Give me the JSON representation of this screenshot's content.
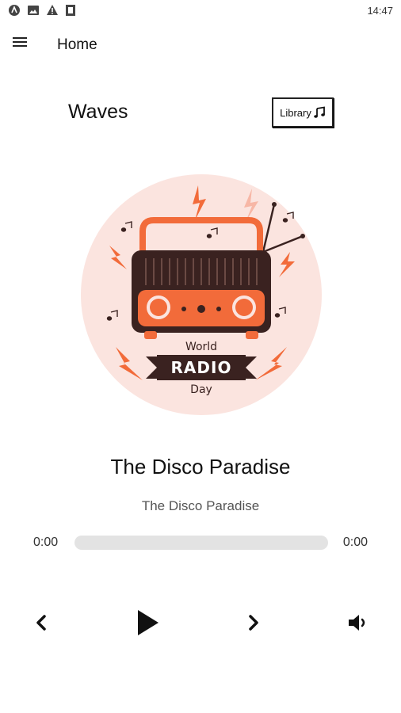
{
  "status_bar": {
    "time": "14:47",
    "icons": [
      "android-icon",
      "image-icon",
      "warning-icon",
      "sd-card-icon"
    ]
  },
  "app_bar": {
    "title": "Home",
    "menu_icon": "hamburger-icon"
  },
  "header": {
    "brand": "Waves",
    "library_label": "Library",
    "library_icon": "music-note-icon"
  },
  "artwork": {
    "line1": "World",
    "line2": "RADIO",
    "line3": "Day"
  },
  "track": {
    "title": "The Disco Paradise",
    "artist": "The Disco Paradise"
  },
  "player": {
    "position": "0:00",
    "duration": "0:00",
    "progress": 0
  },
  "controls": {
    "previous_icon": "chevron-left-icon",
    "play_icon": "play-icon",
    "next_icon": "chevron-right-icon",
    "volume_icon": "volume-icon"
  },
  "colors": {
    "accent": "#f26b3a",
    "dark": "#3a2220",
    "blush": "#fbe4df"
  }
}
